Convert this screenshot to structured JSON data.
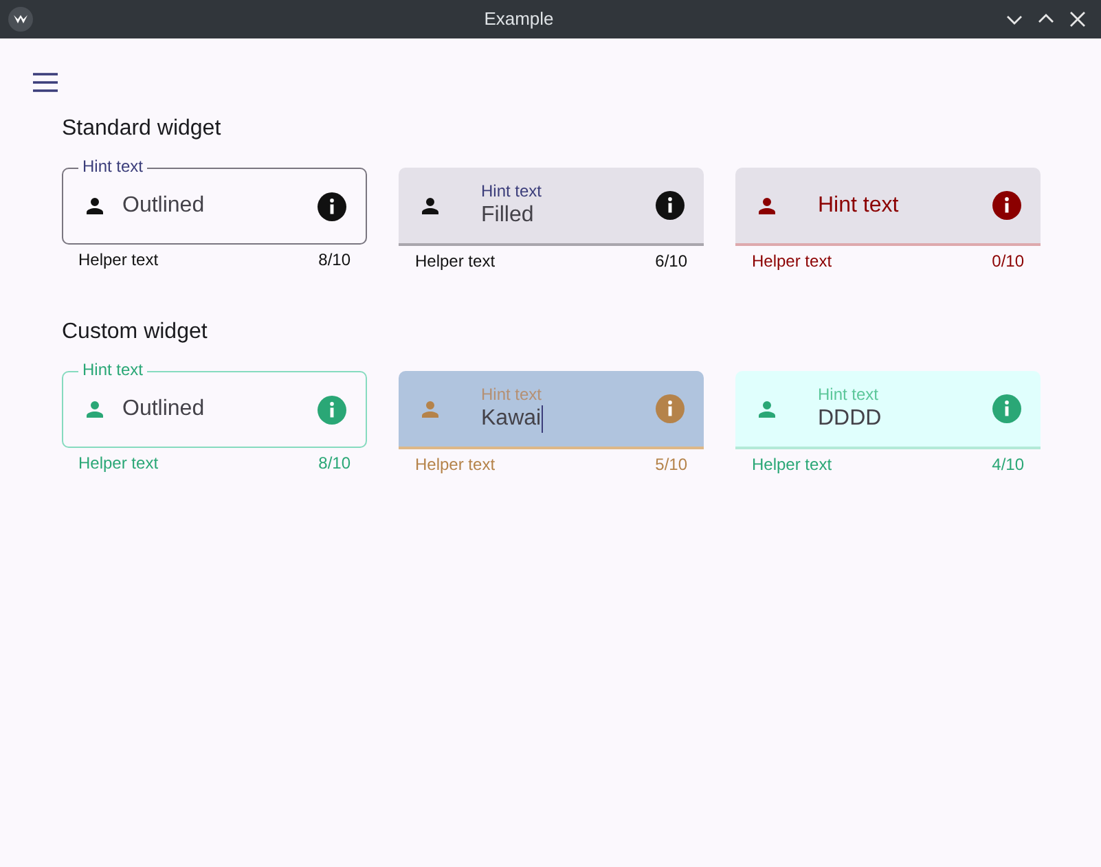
{
  "window": {
    "title": "Example"
  },
  "sections": [
    {
      "title": "Standard widget",
      "fields": [
        {
          "kind": "outlined",
          "hint": "Hint text",
          "value": "Outlined",
          "helper": "Helper text",
          "counter": "8/10",
          "color": "#111111",
          "error": false,
          "focused": false
        },
        {
          "kind": "filled",
          "hint": "Hint text",
          "value": "Filled",
          "helper": "Helper text",
          "counter": "6/10",
          "color": "#111111",
          "error": false,
          "focused": false
        },
        {
          "kind": "filled",
          "placeholder": "Hint text",
          "helper": "Helper text",
          "counter": "0/10",
          "color": "#8b0000",
          "error": true,
          "focused": false
        }
      ]
    },
    {
      "title": "Custom widget",
      "fields": [
        {
          "kind": "outlined",
          "hint": "Hint text",
          "value": "Outlined",
          "helper": "Helper text",
          "counter": "8/10",
          "color": "#2aa776",
          "error": false,
          "focused": false
        },
        {
          "kind": "filled",
          "hint": "Hint text",
          "value": "Kawai",
          "helper": "Helper text",
          "counter": "5/10",
          "color": "#b5834a",
          "error": false,
          "focused": true
        },
        {
          "kind": "filled",
          "hint": "Hint text",
          "value": "DDDD",
          "helper": "Helper text",
          "counter": "4/10",
          "color": "#2aa776",
          "error": false,
          "focused": false
        }
      ]
    }
  ]
}
